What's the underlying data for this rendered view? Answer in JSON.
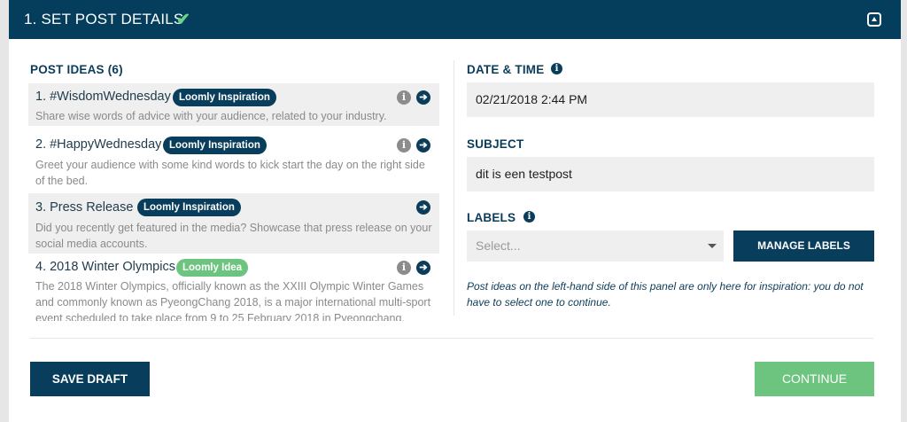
{
  "header": {
    "title": "1. SET POST DETAILS",
    "check_icon": "check-icon",
    "collapse_icon": "collapse-icon"
  },
  "post_ideas": {
    "heading": "POST IDEAS (6)",
    "items": [
      {
        "title": "1. #WisdomWednesday",
        "badge": "Loomly Inspiration",
        "badge_color": "#083e5c",
        "description": "Share wise words of advice with your audience, related to your industry.",
        "has_info": true
      },
      {
        "title": "2. #HappyWednesday",
        "badge": "Loomly Inspiration",
        "badge_color": "#083e5c",
        "description": "Greet your audience with some kind words to kick start the day on the right side of the bed.",
        "has_info": true
      },
      {
        "title": "3. Press Release",
        "badge": "Loomly Inspiration",
        "badge_color": "#083e5c",
        "description": "Did you recently get featured in the media? Showcase that press release on your social media accounts.",
        "has_info": false
      },
      {
        "title": "4. 2018 Winter Olympics",
        "badge": "Loomly Idea",
        "badge_color": "#6cc47f",
        "description": "The 2018 Winter Olympics, officially known as the XXIII Olympic Winter Games and commonly known as PyeongChang 2018, is a major international multi-sport event scheduled to take place from 9 to 25 February 2018 in Pyeongchang,",
        "has_info": true
      }
    ]
  },
  "date_time": {
    "label": "DATE & TIME",
    "value": "02/21/2018 2:44 PM"
  },
  "subject": {
    "label": "SUBJECT",
    "value": "dit is een testpost"
  },
  "labels": {
    "label": "LABELS",
    "placeholder": "Select...",
    "manage_button": "MANAGE LABELS"
  },
  "note": "Post ideas on the left-hand side of this panel are only here for inspiration: you do not have to select one to continue.",
  "footer": {
    "save_draft": "SAVE DRAFT",
    "continue": "CONTINUE"
  },
  "colors": {
    "brand": "#053e5c",
    "accent_green": "#6cc47f",
    "field_bg": "#efefef"
  }
}
